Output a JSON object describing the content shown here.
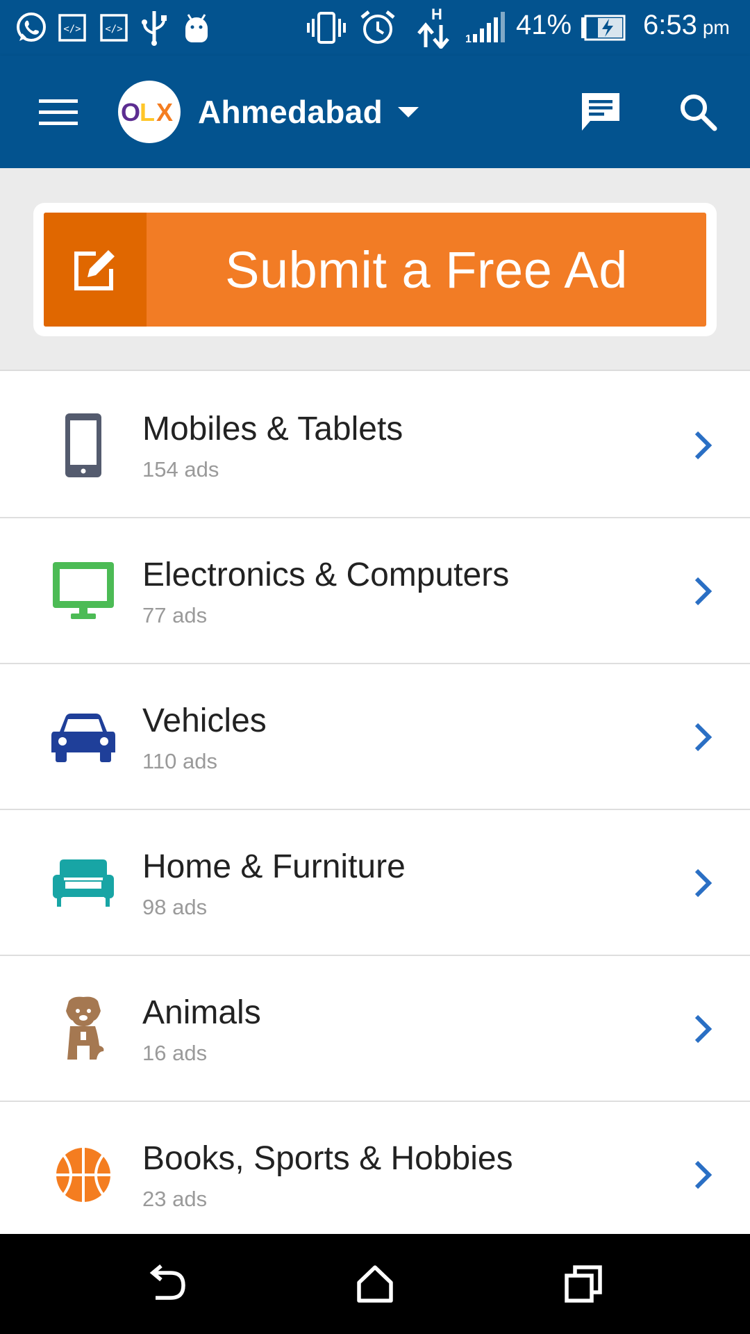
{
  "status_bar": {
    "battery_percent": "41%",
    "time": "6:53",
    "time_suffix": "pm",
    "icons": [
      "whatsapp-icon",
      "code-icon",
      "code-icon",
      "usb-icon",
      "android-icon",
      "vibrate-icon",
      "alarm-icon",
      "data-transfer-icon",
      "signal-icon",
      "battery-charging-icon"
    ]
  },
  "app_bar": {
    "logo_text": "OLX",
    "city": "Ahmedabad",
    "icons": [
      "menu-icon",
      "chat-icon",
      "search-icon"
    ]
  },
  "submit": {
    "label": "Submit a Free Ad",
    "icon": "edit-icon"
  },
  "categories": [
    {
      "title": "Mobiles & Tablets",
      "count": "154 ads",
      "icon": "mobile-icon",
      "color": "#545b6e"
    },
    {
      "title": "Electronics & Computers",
      "count": "77 ads",
      "icon": "monitor-icon",
      "color": "#4cbb55"
    },
    {
      "title": "Vehicles",
      "count": "110 ads",
      "icon": "car-icon",
      "color": "#1f3f99"
    },
    {
      "title": "Home & Furniture",
      "count": "98 ads",
      "icon": "sofa-icon",
      "color": "#18a5a5"
    },
    {
      "title": "Animals",
      "count": "16 ads",
      "icon": "dog-icon",
      "color": "#a57851"
    },
    {
      "title": "Books, Sports & Hobbies",
      "count": "23 ads",
      "icon": "basketball-icon",
      "color": "#f47d20"
    }
  ],
  "colors": {
    "primary": "#03538f",
    "accent": "#f27c25",
    "accent_dark": "#e06700",
    "chevron": "#2a6fc4"
  },
  "nav_bar": {
    "icons": [
      "back-icon",
      "home-icon",
      "recents-icon"
    ]
  }
}
